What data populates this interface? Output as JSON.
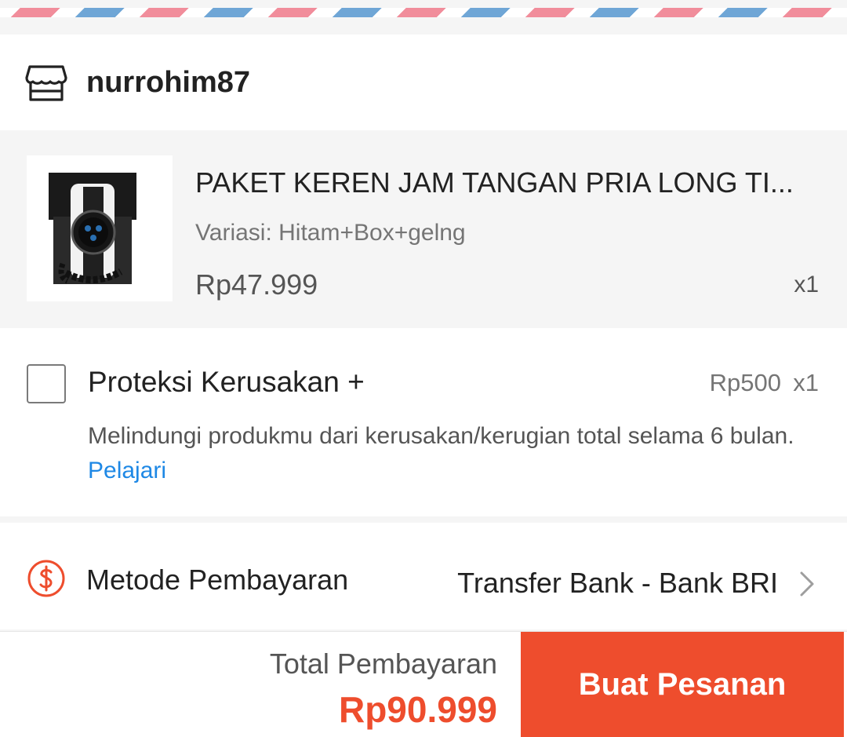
{
  "shop": {
    "name": "nurrohim87",
    "icon": "shop-icon"
  },
  "product": {
    "title": "PAKET KEREN JAM TANGAN PRIA LONG TI...",
    "variant": "Variasi: Hitam+Box+gelng",
    "price": "Rp47.999",
    "qty": "x1",
    "image": "watch-product-image"
  },
  "protection": {
    "title": "Proteksi Kerusakan +",
    "price": "Rp500",
    "qty": "x1",
    "description": "Melindungi produkmu dari kerusakan/kerugian total selama 6 bulan. ",
    "link_label": "Pelajari",
    "checked": false
  },
  "payment": {
    "label": "Metode Pembayaran",
    "value": "Transfer Bank - Bank BRI",
    "icon": "dollar-circle-icon"
  },
  "footer": {
    "total_label": "Total Pembayaran",
    "total_value": "Rp90.999",
    "order_button": "Buat Pesanan"
  },
  "colors": {
    "accent": "#ee4d2d",
    "link": "#1e88e5",
    "stripe_red": "#f18d9b",
    "stripe_blue": "#6fa6d6"
  }
}
